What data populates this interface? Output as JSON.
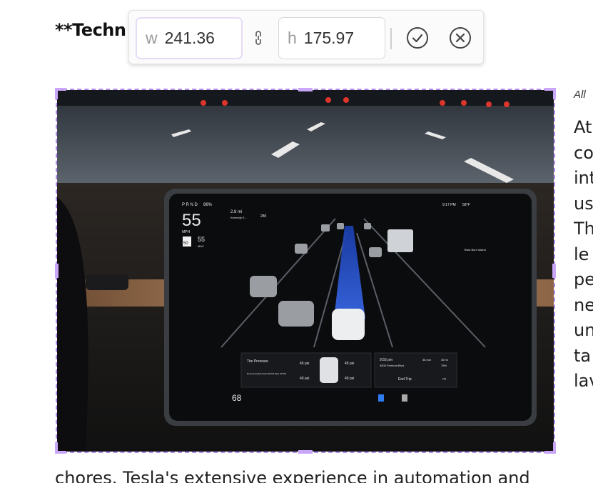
{
  "document": {
    "heading": "**Techn",
    "side_caption": "All",
    "side_lines": [
      "At",
      "co",
      "int",
      "us",
      "Th",
      "le",
      "pe",
      "ne",
      "un",
      "ta",
      "lav"
    ],
    "bottom_line": "chores. Tesla's extensive experience in automation and"
  },
  "resize_toolbar": {
    "width_label": "w",
    "width_value": "241.36",
    "height_label": "h",
    "height_value": "175.97",
    "link_icon": "aspect-link-icon",
    "confirm_icon": "check-circle-icon",
    "cancel_icon": "close-circle-icon"
  },
  "image": {
    "description_icon": "tesla-dashboard-photo",
    "screen": {
      "gear": "P R N D",
      "battery": "86%",
      "speed": "55",
      "speed_unit": "MPH",
      "speed_limit_sign": "50",
      "set_speed": "55",
      "set_speed_unit": "MAX",
      "nav_distance": "2.8 mi",
      "nav_street": "Kennedy E...",
      "route_badge": "280",
      "clock": "9:17 PM",
      "temperature": "58°F",
      "map_label": "Tesla Burn Island",
      "tire_title": "Tire Pressure",
      "tire_fl": "45 psi",
      "tire_fr": "45 psi",
      "tire_rl": "40 psi",
      "tire_rr": "40 psi",
      "tire_note": "Recommended Front 42 PSI Rear 40 PSI",
      "trip_time": "9:55 pm",
      "trip_minutes": "38 min",
      "trip_miles": "35 mi",
      "trip_address": "4500 Fremont Blvd.",
      "trip_battery": "78%",
      "end_trip": "End Trip",
      "more": "•••",
      "cabin_temp": "68"
    }
  },
  "colors": {
    "selection": "#b48ff0",
    "handle": "#c9a6f7",
    "autopilot_path": "#1f52d6"
  }
}
